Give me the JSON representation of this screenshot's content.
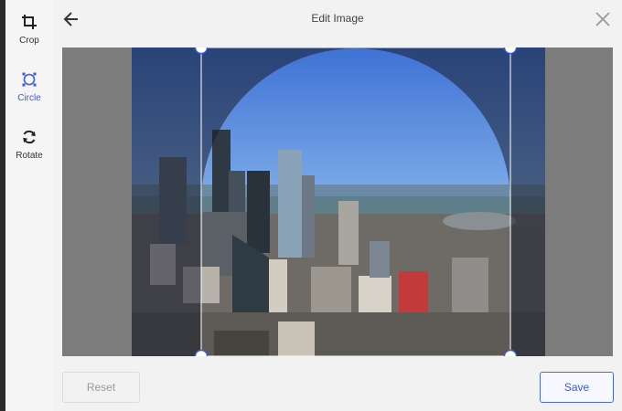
{
  "toolbar": {
    "items": [
      {
        "label": "Crop",
        "icon": "crop-icon",
        "active": false
      },
      {
        "label": "Circle",
        "icon": "circle-select-icon",
        "active": true
      },
      {
        "label": "Rotate",
        "icon": "rotate-icon",
        "active": false
      }
    ]
  },
  "header": {
    "title": "Edit Image",
    "back_icon": "arrow-left-icon",
    "close_icon": "close-icon"
  },
  "footer": {
    "reset_label": "Reset",
    "save_label": "Save"
  },
  "colors": {
    "accent": "#3b5bdb",
    "canvas_bg": "#7c7c7c"
  }
}
